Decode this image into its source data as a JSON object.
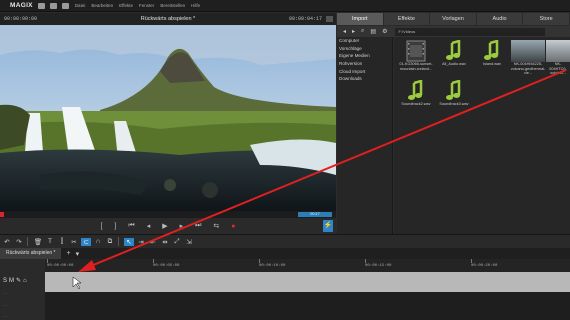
{
  "app": {
    "logo": "MAGIX",
    "menus": [
      "Datei",
      "Bearbeiten",
      "Effekte",
      "Fenster",
      "Bereitstellen",
      "Hilfe"
    ]
  },
  "preview": {
    "timecode_left": "00:00:00:00",
    "title": "Rückwärts abspielen *",
    "timecode_right": "00:00:04:17",
    "position_label": "00:17"
  },
  "media_pool": {
    "tabs": [
      "Import",
      "Effekte",
      "Vorlagen",
      "Audio",
      "Store"
    ],
    "active_tab": "Import",
    "path": "F:\\Videos",
    "folders": [
      "Computer",
      "Vorschläge",
      "Eigene Medien",
      "Rohversion",
      "Cloud Import",
      "Downloads"
    ],
    "files": [
      {
        "name": "01-KG3066-sunset-mountain-iceland...",
        "type": "video"
      },
      {
        "name": "All_Audio.wav",
        "type": "audio"
      },
      {
        "name": "Island.wav",
        "type": "audio"
      },
      {
        "name": "NK-004HM4225-volcano-geothermal-vie...",
        "type": "video"
      },
      {
        "name": "NK-004HTC6-outdoor...",
        "type": "video"
      },
      {
        "name": "Soundtrack2.wav",
        "type": "audio"
      },
      {
        "name": "Soundtrack3.wav",
        "type": "audio"
      }
    ]
  },
  "timeline": {
    "tab_label": "Rückwärts abspielen *",
    "ruler_ticks": [
      "00:00:00:00",
      "00:00:05:00",
      "00:00:10:00",
      "00:00:15:00",
      "00:00:20:00"
    ]
  },
  "colors": {
    "accent": "#2f86c6",
    "arrow": "#e02020"
  }
}
